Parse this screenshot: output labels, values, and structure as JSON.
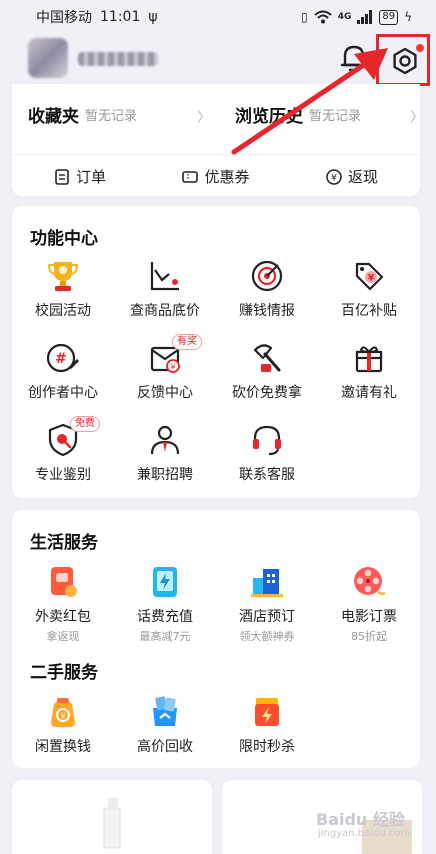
{
  "status_bar": {
    "carrier": "中国移动",
    "time": "11:01",
    "usb_symbol": "ψ",
    "network": "4G",
    "battery": "89"
  },
  "favorites": [
    {
      "title": "收藏夹",
      "sub": "暂无记录"
    },
    {
      "title": "浏览历史",
      "sub": "暂无记录"
    }
  ],
  "orders": [
    {
      "label": "订单",
      "icon": "order-icon"
    },
    {
      "label": "优惠券",
      "icon": "coupon-icon"
    },
    {
      "label": "返现",
      "icon": "yen-icon"
    }
  ],
  "function_center": {
    "title": "功能中心",
    "items": [
      {
        "label": "校园活动",
        "icon": "trophy-icon"
      },
      {
        "label": "查商品底价",
        "icon": "price-chart-icon"
      },
      {
        "label": "赚钱情报",
        "icon": "radar-icon"
      },
      {
        "label": "百亿补贴",
        "icon": "subsidy-tag-icon"
      },
      {
        "label": "创作者中心",
        "icon": "creator-icon"
      },
      {
        "label": "反馈中心",
        "icon": "feedback-icon",
        "badge": "有奖"
      },
      {
        "label": "砍价免费拿",
        "icon": "axe-icon"
      },
      {
        "label": "邀请有礼",
        "icon": "gift-icon"
      },
      {
        "label": "专业鉴别",
        "icon": "shield-search-icon",
        "badge": "免费"
      },
      {
        "label": "兼职招聘",
        "icon": "recruit-icon"
      },
      {
        "label": "联系客服",
        "icon": "headset-icon"
      }
    ]
  },
  "life_services": {
    "title": "生活服务",
    "items": [
      {
        "label": "外卖红包",
        "sub": "拿返现",
        "icon": "takeout-icon"
      },
      {
        "label": "话费充值",
        "sub": "最高减7元",
        "icon": "phone-charge-icon"
      },
      {
        "label": "酒店预订",
        "sub": "领大额神券",
        "icon": "hotel-icon"
      },
      {
        "label": "电影订票",
        "sub": "85折起",
        "icon": "film-reel-icon"
      }
    ]
  },
  "second_hand": {
    "title": "二手服务",
    "items": [
      {
        "label": "闲置换钱",
        "icon": "swap-money-icon"
      },
      {
        "label": "高价回收",
        "icon": "recycle-box-icon"
      },
      {
        "label": "限时秒杀",
        "icon": "flash-sale-icon"
      }
    ]
  },
  "watermark": {
    "main": "Baidu 经验",
    "sub": "jingyan.baidu.com"
  },
  "colors": {
    "accent_red": "#e5262a",
    "background": "#f1f0f6"
  }
}
